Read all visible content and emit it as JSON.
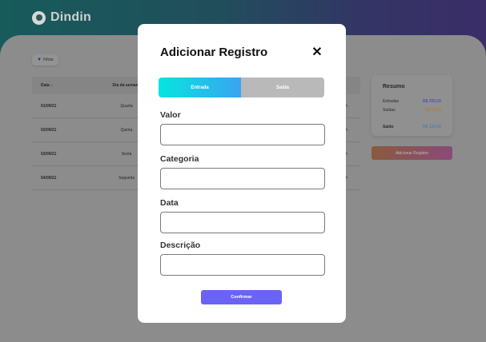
{
  "app": {
    "name": "Dindin"
  },
  "toolbar": {
    "filter_label": "Filtrar"
  },
  "table": {
    "headers": {
      "date": "Data",
      "date_sort": "↓",
      "weekday": "Dia da semana"
    },
    "rows": [
      {
        "date": "01/09/21",
        "weekday": "Quarta"
      },
      {
        "date": "02/09/21",
        "weekday": "Quinta"
      },
      {
        "date": "03/09/21",
        "weekday": "Sexta"
      },
      {
        "date": "04/09/21",
        "weekday": "Segunda"
      }
    ]
  },
  "summary": {
    "title": "Resumo",
    "income_label": "Entradas",
    "income_value": "R$ 200,00",
    "expense_label": "Saídas",
    "expense_value": "R$ 70,50",
    "balance_label": "Saldo",
    "balance_value": "R$ 129,50",
    "colors": {
      "income": "#3a3ab0",
      "expense": "#b07a20",
      "balance": "#3a7ab0"
    }
  },
  "add_button_label": "Adicionar Registro",
  "modal": {
    "title": "Adicionar Registro",
    "close_symbol": "✕",
    "toggle": {
      "income": "Entrada",
      "expense": "Saída",
      "selected": "Entrada"
    },
    "fields": {
      "value_label": "Valor",
      "value": "",
      "category_label": "Categoria",
      "category": "",
      "date_label": "Data",
      "date": "",
      "description_label": "Descrição",
      "description": ""
    },
    "confirm_label": "Confirmar",
    "accent": "#6b63f4"
  }
}
